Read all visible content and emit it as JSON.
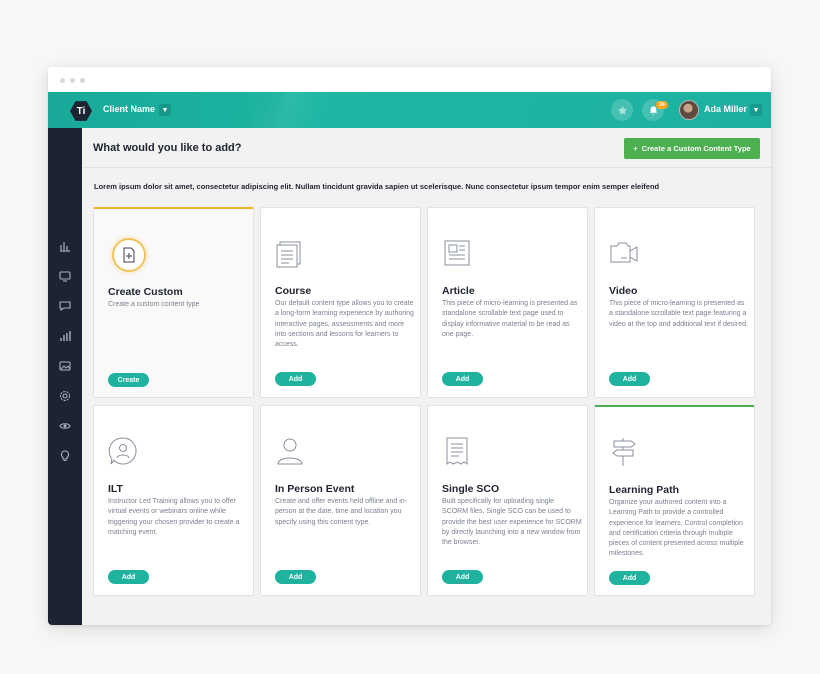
{
  "topbar": {
    "logo_text": "Ti",
    "client_name": "Client Name",
    "notification_count": "24",
    "user_name": "Ada Miller"
  },
  "header": {
    "title": "What would you like to add?",
    "create_button_label": "Create a Custom Content Type",
    "create_button_icon": "+"
  },
  "intro": "Lorem ipsum dolor sit amet, consectetur adipiscing elit. Nullam tincidunt gravida sapien ut scelerisque. Nunc consectetur ipsum tempor enim semper eleifend",
  "sidebar": {
    "icons": [
      "reports-icon",
      "monitor-icon",
      "chat-icon",
      "bar-chart-icon",
      "image-icon",
      "settings-icon",
      "eye-icon",
      "lightbulb-icon"
    ]
  },
  "cards": [
    {
      "title": "Create Custom",
      "desc": "Create a custom content type",
      "button": "Create",
      "icon": "custom-file-icon"
    },
    {
      "title": "Course",
      "desc": "Our default content type allows you to create a long-form learning experience by authoring interactive pages, assessments and more into sections and lessons for learners to access.",
      "button": "Add",
      "icon": "course-icon"
    },
    {
      "title": "Article",
      "desc": "This piece of micro-learning is presented as standalone scrollable text page used to display informative material to be read as one page.",
      "button": "Add",
      "icon": "article-icon"
    },
    {
      "title": "Video",
      "desc": "This piece of micro-learning is presented as a standalone scrollable text page featuring a video at the top and additional text if desired.",
      "button": "Add",
      "icon": "video-icon"
    },
    {
      "title": "ILT",
      "desc": "Instructor Led Training allows you to offer virtual events or webinars online while triggering your chosen provider to create a matching event.",
      "button": "Add",
      "icon": "ilt-icon"
    },
    {
      "title": "In Person Event",
      "desc": "Create and offer events held offline and in-person at the date, time and location you specify using this content type.",
      "button": "Add",
      "icon": "person-icon"
    },
    {
      "title": "Single SCO",
      "desc": "Built specifically for uploading single SCORM files, Single SCO can be used to provide the best user experience for SCORM by directly launching into a new window from the browser.",
      "button": "Add",
      "icon": "receipt-icon"
    },
    {
      "title": "Learning Path",
      "desc": "Organize your authored content into a Learning Path to provide a controlled experience for learners. Control completion and certification criteria through multiple pieces of content presented across multiple milestones.",
      "button": "Add",
      "icon": "signpost-icon"
    }
  ],
  "colors": {
    "topbar": "#1cb0a0",
    "sidebar": "#1d2431",
    "accent_button": "#1fb39f",
    "create_type_button": "#4caf50",
    "highlight_yellow": "#f0b429"
  }
}
